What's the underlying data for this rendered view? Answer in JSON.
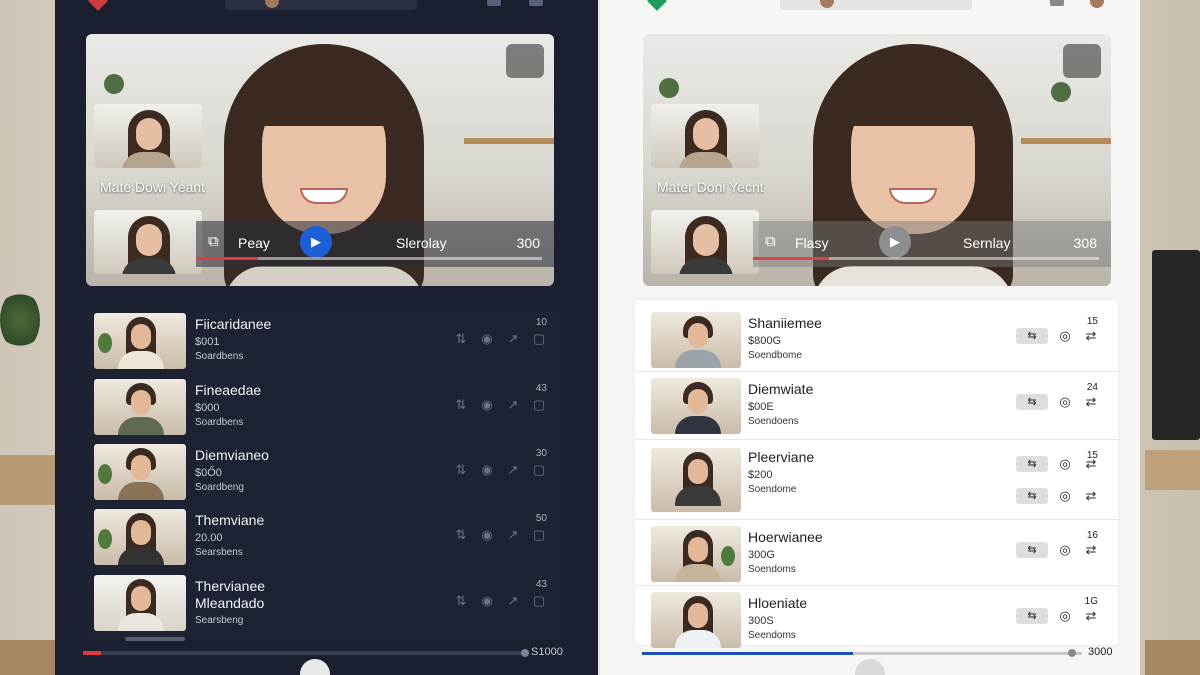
{
  "colors": {
    "dark_panel": "#1b2030",
    "light_panel": "#f6f6f6",
    "accent_blue": "#1d5fd6",
    "accent_red": "#e23b3b"
  },
  "left": {
    "player": {
      "camera_name": "Mate Dowi Yeant",
      "play_label": "Peay",
      "overlay_label": "Slerolay",
      "count": "300",
      "progress": 0.18
    },
    "items": [
      {
        "title": "Fiicaridanee",
        "price": "$001",
        "sub": "Soardbens",
        "num": "10"
      },
      {
        "title": "Fineaedae",
        "price": "$000",
        "sub": "Soardbens",
        "num": "43"
      },
      {
        "title": "Diemvianeo",
        "price": "$0Ő0",
        "sub": "Soardbeng",
        "num": "30"
      },
      {
        "title": "Themviane",
        "price": "20.00",
        "sub": "Searsbens",
        "num": "50"
      },
      {
        "title": "Thervianee",
        "title2": "Mleandado",
        "sub": "Searsbeng",
        "num": "43"
      }
    ],
    "scrub": {
      "label": "S1000",
      "progress": 0.04
    }
  },
  "right": {
    "player": {
      "camera_name": "Mater Doni Yecnt",
      "play_label": "Flasy",
      "overlay_label": "Sernlay",
      "count": "308",
      "progress": 0.22
    },
    "items": [
      {
        "title": "Shaniiemee",
        "price": "$800G",
        "sub": "Soendbome",
        "num": "15"
      },
      {
        "title": "Diemwiate",
        "price": "$00E",
        "sub": "Soendoens",
        "num": "24"
      },
      {
        "title": "Pleerviane",
        "price": "$200",
        "sub": "Soendome",
        "num": "15"
      },
      {
        "title": "Hoerwianee",
        "price": "300G",
        "sub": "Soendoms",
        "num": "16"
      },
      {
        "title": "Hloeniate",
        "price": "300S",
        "sub": "Seendoms",
        "num": "1G"
      }
    ],
    "scrub": {
      "label": "3000",
      "progress": 0.48
    }
  },
  "icons": {
    "captions": "captions-icon",
    "play": "play-icon",
    "shuffle": "shuffle-icon",
    "view": "eye-icon",
    "share": "share-icon",
    "save": "bookmark-icon"
  }
}
